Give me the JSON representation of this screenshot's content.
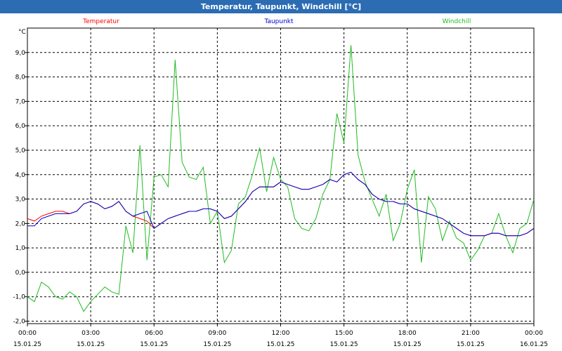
{
  "window": {
    "title": "Temperatur, Taupunkt, Windchill [°C]"
  },
  "chart_data": {
    "type": "line",
    "title": "Temperatur, Taupunkt, Windchill [°C]",
    "ylabel": "°C",
    "ylim": [
      -2.1,
      10.0
    ],
    "grid": true,
    "legend_placement": "top",
    "yticks": [
      "9,0",
      "8,0",
      "7,0",
      "6,0",
      "5,0",
      "4,0",
      "3,0",
      "2,0",
      "1,0",
      "0,0",
      "-1,0",
      "-2,0"
    ],
    "xticks": [
      {
        "time": "00:00",
        "date": "15.01.25"
      },
      {
        "time": "03:00",
        "date": "15.01.25"
      },
      {
        "time": "06:00",
        "date": "15.01.25"
      },
      {
        "time": "09:00",
        "date": "15.01.25"
      },
      {
        "time": "12:00",
        "date": "15.01.25"
      },
      {
        "time": "15:00",
        "date": "15.01.25"
      },
      {
        "time": "18:00",
        "date": "15.01.25"
      },
      {
        "time": "21:00",
        "date": "15.01.25"
      },
      {
        "time": "00:00",
        "date": "16.01.25"
      }
    ],
    "x": [
      "00:00",
      "00:20",
      "00:40",
      "01:00",
      "01:20",
      "01:40",
      "02:00",
      "02:20",
      "02:40",
      "03:00",
      "03:20",
      "03:40",
      "04:00",
      "04:20",
      "04:40",
      "05:00",
      "05:20",
      "05:40",
      "06:00",
      "06:20",
      "06:40",
      "07:00",
      "07:20",
      "07:40",
      "08:00",
      "08:20",
      "08:40",
      "09:00",
      "09:20",
      "09:40",
      "10:00",
      "10:20",
      "10:40",
      "11:00",
      "11:20",
      "11:40",
      "12:00",
      "12:20",
      "12:40",
      "13:00",
      "13:20",
      "13:40",
      "14:00",
      "14:20",
      "14:40",
      "15:00",
      "15:20",
      "15:40",
      "16:00",
      "16:20",
      "16:40",
      "17:00",
      "17:20",
      "17:40",
      "18:00",
      "18:20",
      "18:40",
      "19:00",
      "19:20",
      "19:40",
      "20:00",
      "20:20",
      "20:40",
      "21:00",
      "21:20",
      "21:40",
      "22:00",
      "22:20",
      "22:40",
      "23:00",
      "23:20",
      "23:40",
      "24:00"
    ],
    "series": [
      {
        "name": "Temperatur",
        "color": "#ff0000",
        "values": [
          2.2,
          2.1,
          2.3,
          2.4,
          2.5,
          2.5,
          2.4,
          2.5,
          2.8,
          2.9,
          2.8,
          2.6,
          2.7,
          2.9,
          2.5,
          2.3,
          2.2,
          2.1,
          1.8,
          2.0,
          2.2,
          2.3,
          2.4,
          2.5,
          2.5,
          2.6,
          2.6,
          2.5,
          2.2,
          2.3,
          2.6,
          2.9,
          3.3,
          3.5,
          3.5,
          3.5,
          3.7,
          3.6,
          3.5,
          3.4,
          3.4,
          3.5,
          3.6,
          3.8,
          3.7,
          4.0,
          4.1,
          3.8,
          3.6,
          3.2,
          3.0,
          2.9,
          2.9,
          2.8,
          2.8,
          2.6,
          2.5,
          2.4,
          2.3,
          2.2,
          2.0,
          1.8,
          1.6,
          1.5,
          1.5,
          1.5,
          1.6,
          1.6,
          1.5,
          1.5,
          1.5,
          1.6,
          1.8
        ]
      },
      {
        "name": "Taupunkt",
        "color": "#0000cc",
        "values": [
          1.9,
          1.9,
          2.2,
          2.3,
          2.4,
          2.4,
          2.4,
          2.5,
          2.8,
          2.9,
          2.8,
          2.6,
          2.7,
          2.9,
          2.5,
          2.3,
          2.4,
          2.5,
          1.8,
          2.0,
          2.2,
          2.3,
          2.4,
          2.5,
          2.5,
          2.6,
          2.6,
          2.5,
          2.2,
          2.3,
          2.6,
          2.9,
          3.3,
          3.5,
          3.5,
          3.5,
          3.7,
          3.6,
          3.5,
          3.4,
          3.4,
          3.5,
          3.6,
          3.8,
          3.7,
          4.0,
          4.1,
          3.8,
          3.6,
          3.2,
          3.0,
          2.9,
          2.9,
          2.8,
          2.8,
          2.6,
          2.5,
          2.4,
          2.3,
          2.2,
          2.0,
          1.8,
          1.6,
          1.5,
          1.5,
          1.5,
          1.6,
          1.6,
          1.5,
          1.5,
          1.5,
          1.6,
          1.8
        ]
      },
      {
        "name": "Windchill",
        "color": "#22bb22",
        "values": [
          -1.0,
          -1.2,
          -0.4,
          -0.6,
          -1.0,
          -1.1,
          -0.8,
          -1.0,
          -1.6,
          -1.2,
          -0.9,
          -0.6,
          -0.8,
          -0.9,
          1.9,
          0.8,
          5.2,
          0.5,
          3.9,
          4.0,
          3.5,
          8.7,
          4.5,
          3.9,
          3.8,
          4.3,
          2.0,
          2.5,
          0.4,
          0.9,
          2.8,
          3.1,
          4.0,
          5.1,
          3.3,
          4.7,
          3.8,
          3.5,
          2.2,
          1.8,
          1.7,
          2.2,
          3.2,
          3.8,
          6.5,
          5.3,
          9.3,
          4.8,
          3.7,
          3.0,
          2.3,
          3.2,
          1.3,
          2.0,
          3.4,
          4.2,
          0.4,
          3.1,
          2.6,
          1.3,
          2.1,
          1.4,
          1.2,
          0.5,
          0.9,
          1.5,
          1.6,
          2.4,
          1.5,
          0.8,
          1.8,
          2.0,
          3.0
        ]
      }
    ]
  }
}
